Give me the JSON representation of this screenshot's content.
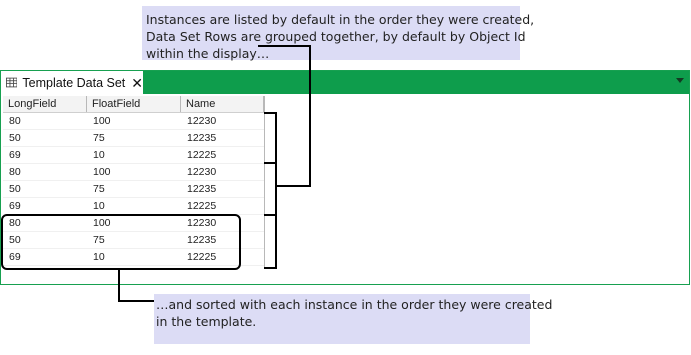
{
  "annotations": {
    "top_note": [
      "Instances are listed by default in the order they were created,",
      "Data Set Rows are grouped together, by default by Object Id",
      "within the display…"
    ],
    "bottom_note": [
      "…and sorted with each instance in the order they were created",
      "in the template."
    ]
  },
  "tab": {
    "title": "Template Data Set",
    "close_glyph": "✕",
    "icon": "table-grid-icon"
  },
  "panel": {
    "accent_color": "#0e9d4c"
  },
  "grid": {
    "columns": [
      "LongField",
      "FloatField",
      "Name"
    ],
    "rows": [
      [
        "80",
        "100",
        "12230"
      ],
      [
        "50",
        "75",
        "12235"
      ],
      [
        "69",
        "10",
        "12225"
      ],
      [
        "80",
        "100",
        "12230"
      ],
      [
        "50",
        "75",
        "12235"
      ],
      [
        "69",
        "10",
        "12225"
      ],
      [
        "80",
        "100",
        "12230"
      ],
      [
        "50",
        "75",
        "12235"
      ],
      [
        "69",
        "10",
        "12225"
      ]
    ]
  }
}
